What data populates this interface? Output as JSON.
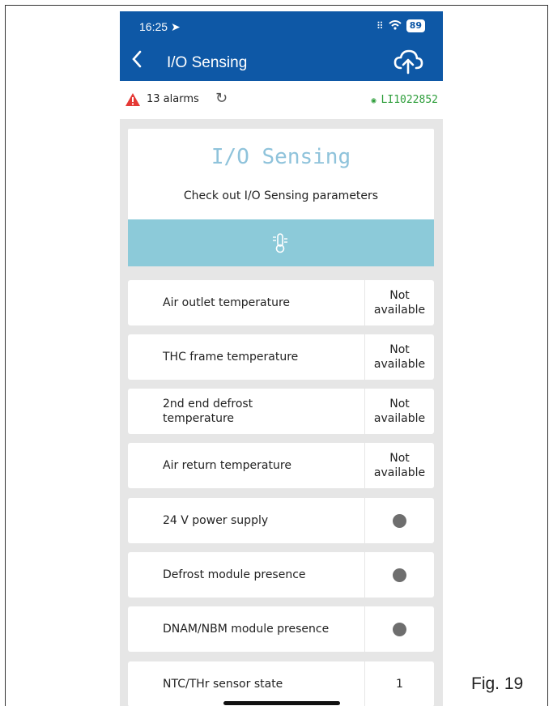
{
  "status": {
    "time": "16:25",
    "battery": "89"
  },
  "nav": {
    "title": "I/O Sensing"
  },
  "alarms": {
    "text": "13 alarms",
    "device_id": "LI1022852"
  },
  "header": {
    "title": "I/O Sensing",
    "subtitle": "Check out I/O Sensing parameters"
  },
  "rows": [
    {
      "label": "Air outlet temperature",
      "value": "Not available"
    },
    {
      "label": "THC frame temperature",
      "value": "Not available"
    },
    {
      "label": "2nd end defrost temperature",
      "value": "Not available"
    },
    {
      "label": "Air return temperature",
      "value": "Not available"
    },
    {
      "label": "24 V power supply",
      "value_icon": "grey-dot"
    },
    {
      "label": "Defrost module presence",
      "value_icon": "grey-dot"
    },
    {
      "label": "DNAM/NBM module presence",
      "value_icon": "grey-dot"
    },
    {
      "label": "NTC/THr sensor state",
      "value": "1"
    }
  ],
  "figure": {
    "label": "Fig. 19"
  },
  "colors": {
    "nav_bar": "#0e58a6",
    "accent_light": "#8ccad9",
    "title_text": "#8fc3db",
    "device_ok": "#2e9e3b",
    "alarm": "#e53935"
  }
}
